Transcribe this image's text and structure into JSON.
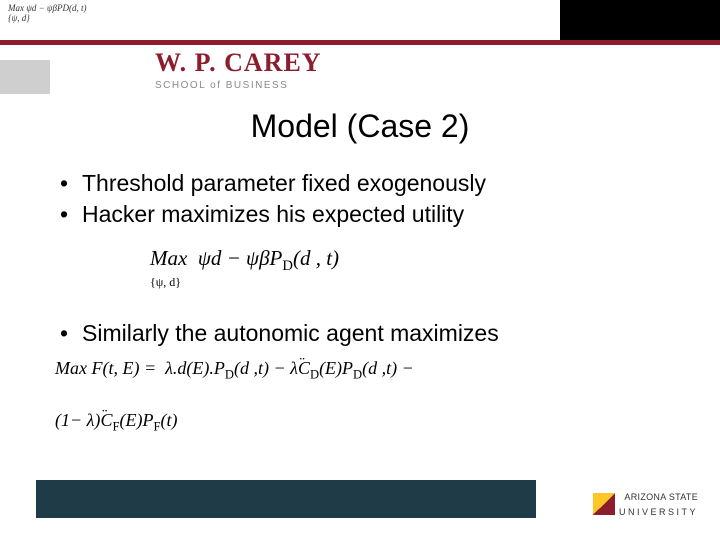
{
  "top_formula_line1": "Max ψd − ψβPD(d, t)",
  "top_formula_line2": "{ψ, d}",
  "logo": {
    "main": "W. P. CAREY",
    "sub": "SCHOOL of BUSINESS"
  },
  "title": "Model (Case 2)",
  "bullets": [
    "Threshold parameter fixed exogenously",
    "Hacker maximizes his expected utility"
  ],
  "formula1": {
    "main": "Max  ψd − ψβPD(d , t)",
    "sub": "{ψ, d}"
  },
  "bullets2": [
    "Similarly the autonomic agent maximizes"
  ],
  "formula2": {
    "line1": "Max F(t, E) =  λ.d(E).PD(d ,t) − λC̈D(E)PD(d ,t) −",
    "line2": "(1− λ)C̈F(E)PF(t)"
  },
  "asu": {
    "top": "ARIZONA STATE",
    "bottom": "UNIVERSITY"
  }
}
